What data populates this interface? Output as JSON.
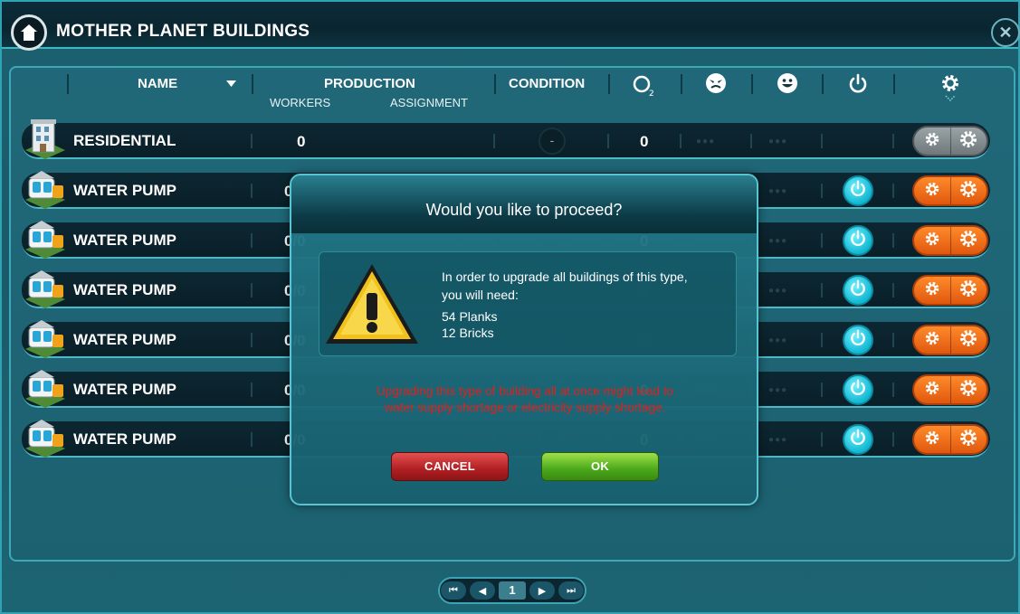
{
  "window": {
    "title": "MOTHER PLANET BUILDINGS"
  },
  "columns": {
    "name": "NAME",
    "production": "PRODUCTION",
    "workers": "WORKERS",
    "assignment": "ASSIGNMENT",
    "condition": "CONDITION",
    "oxygen_icon": "o2-icon",
    "angry_icon": "angry-face-icon",
    "happy_icon": "happy-face-icon",
    "power_icon": "power-icon",
    "settings_icon": "gear-icon"
  },
  "rows": [
    {
      "name": "RESIDENTIAL",
      "workers": "0",
      "condition": "-",
      "o2": "0",
      "status": "disabled"
    },
    {
      "name": "WATER PUMP",
      "workers": "0/0",
      "condition": "",
      "o2": "0",
      "status": "active"
    },
    {
      "name": "WATER PUMP",
      "workers": "0/0",
      "condition": "",
      "o2": "0",
      "status": "active"
    },
    {
      "name": "WATER PUMP",
      "workers": "0/0",
      "condition": "",
      "o2": "0",
      "status": "active"
    },
    {
      "name": "WATER PUMP",
      "workers": "0/0",
      "condition": "",
      "o2": "0",
      "status": "active"
    },
    {
      "name": "WATER PUMP",
      "workers": "0/0",
      "condition": "",
      "o2": "0",
      "status": "active"
    },
    {
      "name": "WATER PUMP",
      "workers": "0/0",
      "condition": "",
      "o2": "0",
      "status": "active"
    }
  ],
  "dialog": {
    "title": "Would you like to proceed?",
    "message_line1": "In order to upgrade all buildings of this type,",
    "message_line2": "you will need:",
    "requirement1": "54 Planks",
    "requirement2": "12 Bricks",
    "warning_line1": "Upgrading this type of building all at once might lead to",
    "warning_line2": "water supply shortage or electricity supply shortage.",
    "cancel_label": "CANCEL",
    "ok_label": "OK"
  },
  "pager": {
    "current_page": "1"
  },
  "colors": {
    "warning_red": "#e0201c",
    "accent_cyan": "#3eb7c5",
    "action_orange": "#f07020",
    "ok_green": "#5bb523",
    "cancel_red": "#c5292b"
  }
}
